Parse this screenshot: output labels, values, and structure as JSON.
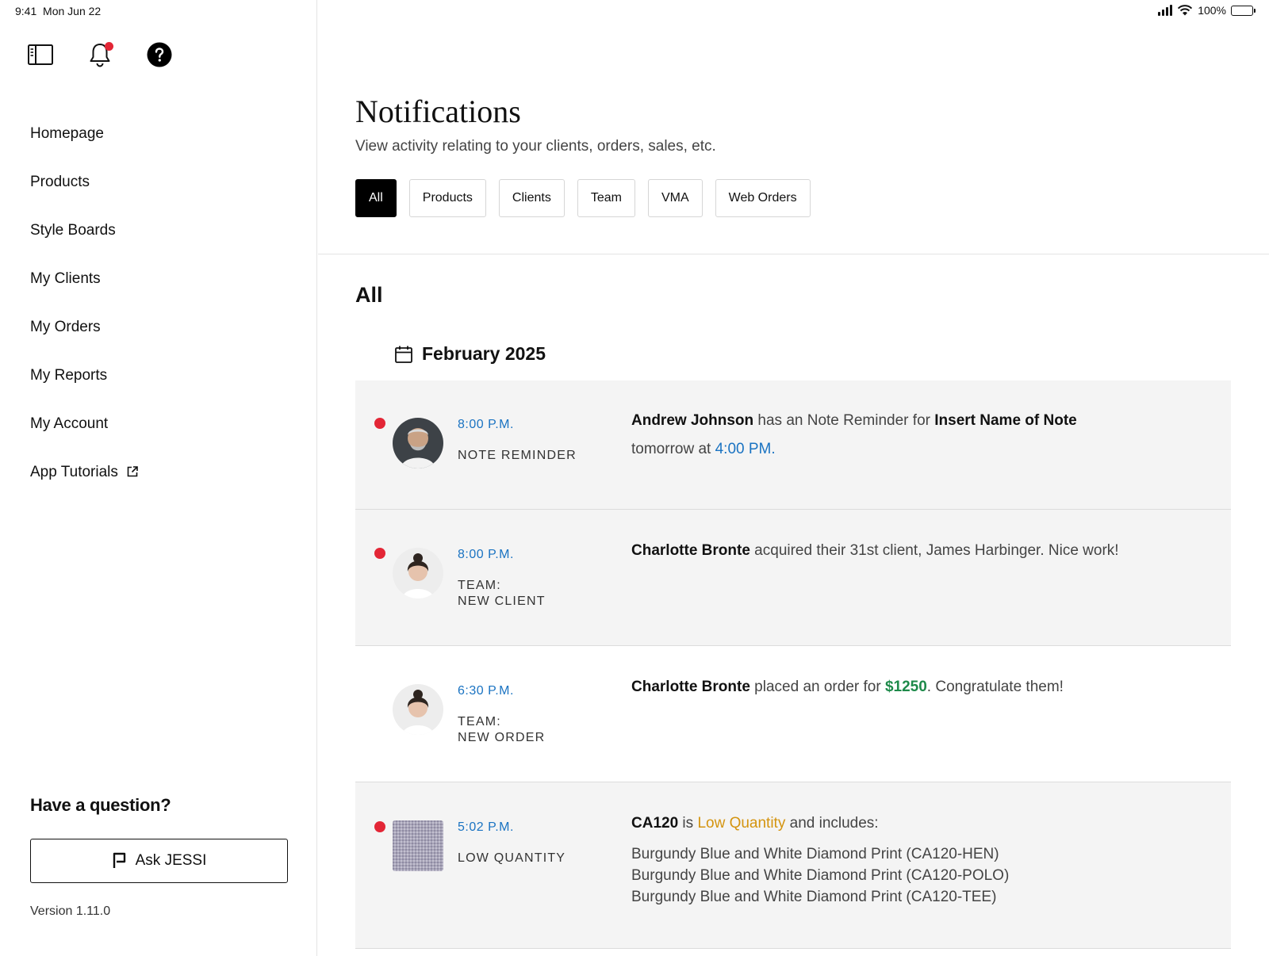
{
  "status_bar": {
    "time": "9:41",
    "date": "Mon Jun 22",
    "battery": "100%"
  },
  "sidebar": {
    "top_icons": [
      "sidebar-toggle-icon",
      "bell-icon",
      "help-icon"
    ],
    "nav": [
      {
        "label": "Homepage"
      },
      {
        "label": "Products"
      },
      {
        "label": "Style Boards"
      },
      {
        "label": "My Clients"
      },
      {
        "label": "My Orders"
      },
      {
        "label": "My Reports"
      },
      {
        "label": "My Account"
      },
      {
        "label": "App Tutorials",
        "icon": "external-link-icon"
      }
    ],
    "question": "Have a question?",
    "ask_button": "Ask JESSI",
    "version": "Version 1.11.0"
  },
  "main": {
    "title": "Notifications",
    "subtitle": "View activity relating to your clients, orders, sales, etc.",
    "tabs": [
      {
        "label": "All",
        "active": true
      },
      {
        "label": "Products"
      },
      {
        "label": "Clients"
      },
      {
        "label": "Team"
      },
      {
        "label": "VMA"
      },
      {
        "label": "Web Orders"
      }
    ],
    "section_title": "All",
    "month": "February 2025",
    "notifications": [
      {
        "unread": true,
        "time": "8:00 P.M.",
        "type_line1": "NOTE REMINDER",
        "name": "Andrew Johnson",
        "text1": " has an Note Reminder for ",
        "note_name": "Insert Name of Note",
        "text2": "tomorrow at ",
        "highlight": "4:00 PM."
      },
      {
        "unread": true,
        "time": "8:00 P.M.",
        "type_line1": "TEAM:",
        "type_line2": "NEW CLIENT",
        "name": "Charlotte Bronte",
        "text1": " acquired their 31st client, James Harbinger. Nice work!"
      },
      {
        "unread": false,
        "time": "6:30 P.M.",
        "type_line1": "TEAM:",
        "type_line2": "NEW ORDER",
        "name": "Charlotte Bronte",
        "text1": " placed an order for ",
        "amount": "$1250",
        "text2": ". Congratulate them!"
      },
      {
        "unread": true,
        "time": "5:02 P.M.",
        "type_line1": "LOW QUANTITY",
        "code": "CA120",
        "text1": " is ",
        "status": "Low Quantity",
        "text2": " and includes:",
        "items": [
          "Burgundy Blue and White Diamond Print (CA120-HEN)",
          "Burgundy Blue and White Diamond Print (CA120-POLO)",
          "Burgundy Blue and White Diamond Print (CA120-TEE)"
        ]
      }
    ]
  },
  "colors": {
    "accent_blue": "#1a73c2",
    "unread_red": "#e32636",
    "amount_green": "#1e8a4a",
    "warning_amber": "#d4940f",
    "card_bg": "#f4f4f4"
  }
}
